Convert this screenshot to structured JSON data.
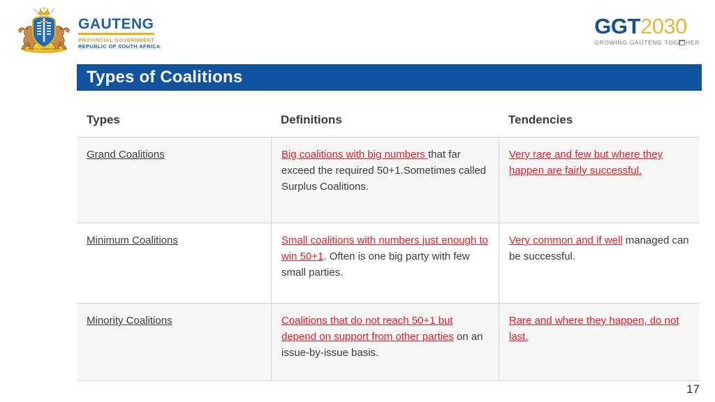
{
  "header": {
    "coat_of_arms_alt": "south-african-coat-of-arms",
    "gauteng": {
      "name": "GAUTENG",
      "line1": "PROVINCIAL GOVERNMENT",
      "line2": "REPUBLIC OF SOUTH AFRICA"
    },
    "ggt": {
      "prefix": "GGT",
      "year": "2030",
      "tagline_before": "GROWING GAUTENG TOG",
      "tagline_after": "HER"
    }
  },
  "slide": {
    "title": "Types of Coalitions",
    "page_number": "17"
  },
  "table": {
    "headers": [
      "Types",
      "Definitions",
      "Tendencies"
    ],
    "rows": [
      {
        "type": "Grand Coalitions",
        "definition_highlight": "Big coalitions with big numbers ",
        "definition_rest": "that far exceed the required 50+1.Sometimes called Surplus Coalitions.",
        "tendency_highlight": "Very rare and few but where they happen are fairly successful.",
        "tendency_rest": ""
      },
      {
        "type": "Minimum Coalitions",
        "definition_highlight": "Small coalitions with numbers just enough to win 50+1",
        "definition_rest": ". Often is one big party with few small parties.",
        "tendency_highlight": "Very common and if well",
        "tendency_rest": " managed can be successful."
      },
      {
        "type": "Minority Coalitions",
        "definition_highlight": "Coalitions that do not reach 50+1 but depend on support from other parties",
        "definition_rest": " on an issue-by-issue basis.",
        "tendency_highlight": "Rare and where they happen, do not last.",
        "tendency_rest": ""
      }
    ]
  },
  "colors": {
    "banner_blue": "#11539e",
    "highlight_red": "#ee1b24",
    "gauteng_blue": "#1f5fa9",
    "gold": "#e0b93c"
  }
}
